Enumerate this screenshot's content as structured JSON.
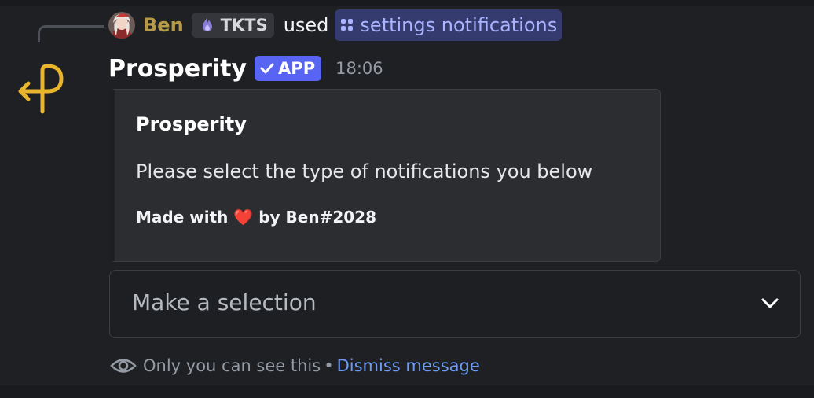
{
  "reply": {
    "username": "Ben",
    "guild_tag": "TKTS",
    "used_text": "used",
    "command": "settings notifications"
  },
  "message": {
    "bot_name": "Prosperity",
    "app_badge": "APP",
    "timestamp": "18:06"
  },
  "embed": {
    "title": "Prosperity",
    "description": "Please select the type of notifications you below",
    "footer": "Made with ❤️ by Ben#2028"
  },
  "select_menu": {
    "placeholder": "Make a selection"
  },
  "ephemeral": {
    "notice": "Only you can see this",
    "separator": "•",
    "dismiss": "Dismiss message"
  },
  "colors": {
    "background": "#1f2023",
    "username": "#b69a48",
    "app_badge": "#5865f2",
    "command_mention_bg": "#353b6e",
    "command_mention_text": "#aab3ff",
    "link": "#6e9cf5",
    "bot_avatar_stroke": "#e8b52c"
  },
  "icons": {
    "reply_avatar": "user-avatar",
    "guild_tag": "flame-icon",
    "command": "slash-command-icon",
    "app_badge": "checkmark-icon",
    "select": "chevron-down-icon",
    "ephemeral": "eye-icon",
    "bot_avatar": "prosperity-logo"
  }
}
